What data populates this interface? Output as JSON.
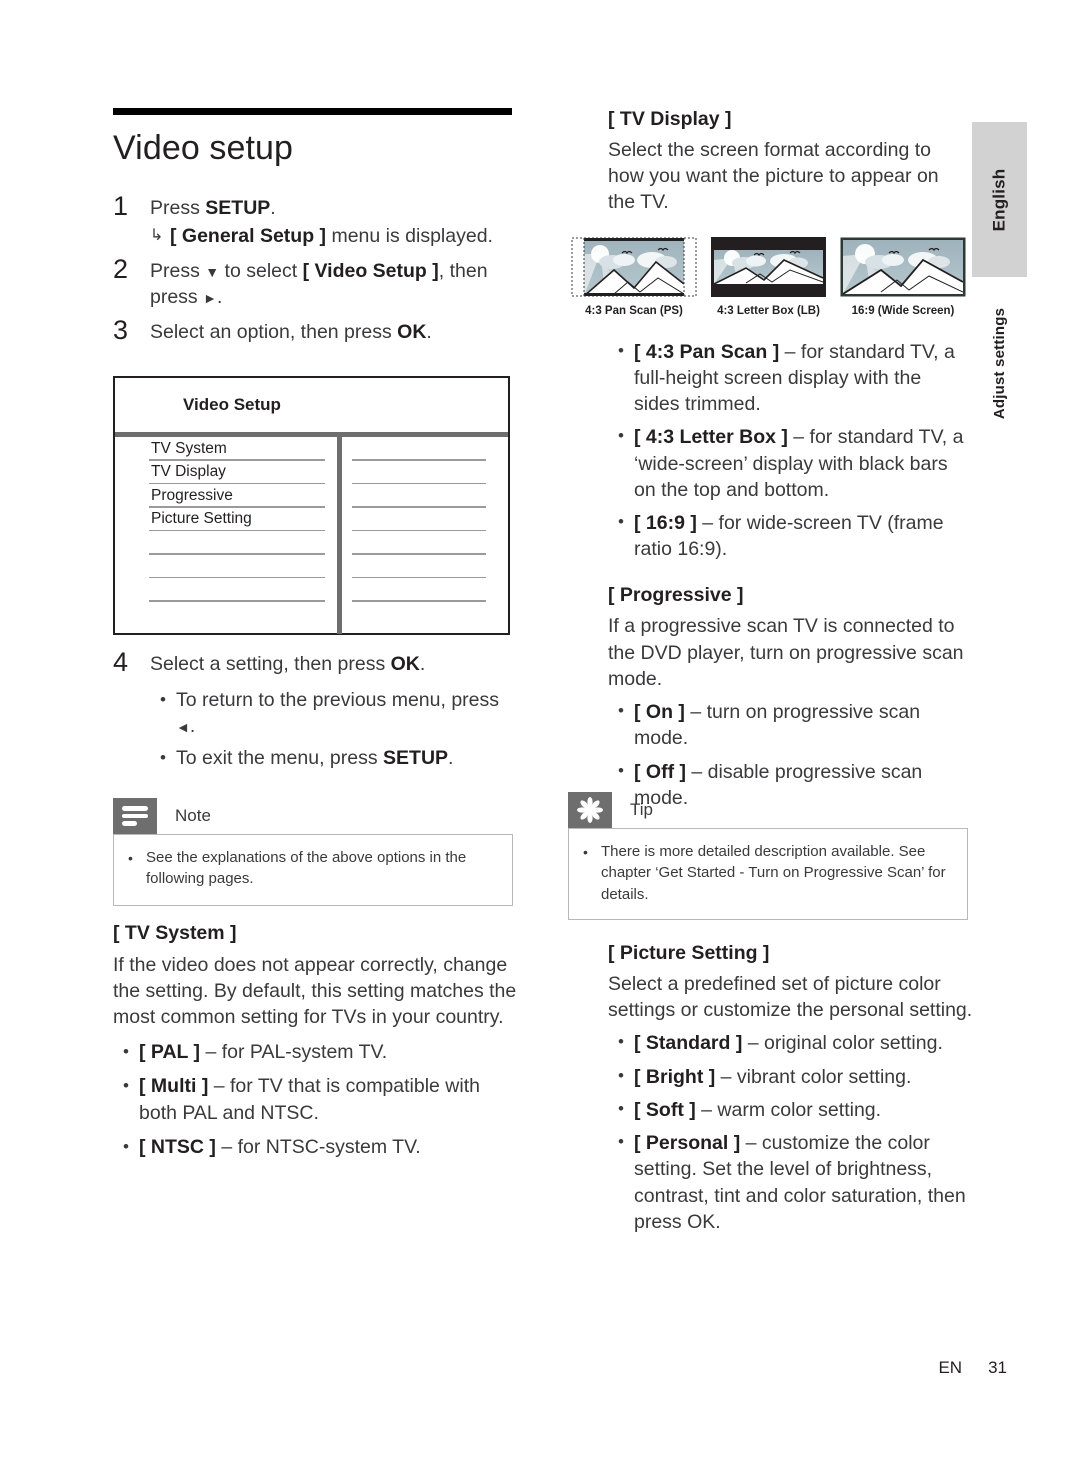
{
  "page": {
    "title": "Video setup",
    "footer_prefix": "EN",
    "footer_page": "31",
    "side_language": "English",
    "side_section": "Adjust settings"
  },
  "steps": [
    {
      "num": "1",
      "text_before": "Press ",
      "bold": "SETUP",
      "text_after": ".",
      "sub": {
        "arrow": "↳",
        "bold": "[ General Setup ]",
        "text_after": " menu is displayed."
      }
    },
    {
      "num": "2",
      "text_before": "Press ",
      "glyph1": "▼",
      "mid": " to select ",
      "bold": "[ Video Setup ]",
      "text_after": ", then press ",
      "glyph2": "►",
      "end": "."
    },
    {
      "num": "3",
      "text_before": "Select an option, then press ",
      "bold": "OK",
      "text_after": "."
    },
    {
      "num": "4",
      "text_before": "Select a setting, then press ",
      "bold": "OK",
      "text_after": ".",
      "bullets": [
        {
          "text_before": "To return to the previous menu, press ",
          "glyph": "◄",
          "text_after": "."
        },
        {
          "text_before": "To exit the menu, press ",
          "bold": "SETUP",
          "text_after": "."
        }
      ]
    }
  ],
  "video_setup_table": {
    "header": "Video Setup",
    "rows": [
      "TV System",
      "TV Display",
      "Progressive",
      "Picture Setting",
      "",
      "",
      "",
      ""
    ],
    "right_rows": [
      "",
      "",
      "",
      "",
      "",
      "",
      "",
      ""
    ]
  },
  "note": {
    "icon": "note-lines-icon",
    "label": "Note",
    "items": [
      "See the explanations of the above options in the following pages."
    ]
  },
  "tip": {
    "icon": "asterisk-icon",
    "label": "Tip",
    "items": [
      "There is more detailed description available. See chapter ‘Get Started - Turn on Progressive Scan’ for details."
    ]
  },
  "tv_system": {
    "heading": "[ TV System ]",
    "paragraph": "If the video does not appear correctly, change the setting. By default, this setting matches the most common setting for TVs in your country.",
    "bullets": [
      {
        "bold": "[ PAL ]",
        "rest": " – for PAL-system TV."
      },
      {
        "bold": "[ Multi ]",
        "rest": " – for TV that is compatible with both PAL and NTSC."
      },
      {
        "bold": "[ NTSC ]",
        "rest": " – for NTSC-system TV."
      }
    ]
  },
  "tv_display": {
    "heading": "[ TV Display ]",
    "paragraph": "Select the screen format according to how you want the picture to appear on the TV.",
    "figures": [
      {
        "name": "pan-scan-figure",
        "caption": "4:3 Pan Scan (PS)"
      },
      {
        "name": "letter-box-figure",
        "caption": "4:3 Letter Box (LB)"
      },
      {
        "name": "wide-screen-figure",
        "caption": "16:9 (Wide Screen)"
      }
    ],
    "bullets": [
      {
        "bold": "[ 4:3 Pan Scan ]",
        "rest": " – for standard TV, a full-height screen display with the sides trimmed."
      },
      {
        "bold": "[ 4:3 Letter Box ]",
        "rest": " – for standard TV,  a ‘wide-screen’ display with black bars on the top and bottom."
      },
      {
        "bold": "[ 16:9 ]",
        "rest": " – for wide-screen TV (frame ratio 16:9)."
      }
    ]
  },
  "progressive": {
    "heading": "[ Progressive ]",
    "paragraph": "If a progressive scan TV is connected to the DVD player, turn on progressive scan mode.",
    "bullets": [
      {
        "bold": "[ On ]",
        "rest": " – turn on progressive scan mode."
      },
      {
        "bold": "[ Off ]",
        "rest": " – disable progressive scan mode."
      }
    ]
  },
  "picture_setting": {
    "heading": "[ Picture Setting ]",
    "paragraph": "Select a predefined set of picture color settings or customize the personal setting.",
    "bullets": [
      {
        "bold": "[ Standard ]",
        "rest": " – original color setting."
      },
      {
        "bold": "[ Bright ]",
        "rest": " – vibrant color setting."
      },
      {
        "bold": "[ Soft ]",
        "rest": " – warm color setting."
      },
      {
        "bold": "[ Personal ]",
        "rest": " – customize the color setting. Set the level of brightness, contrast, tint and color saturation, then press OK."
      }
    ]
  },
  "colors": {
    "rule": "#000000",
    "callout_tab": "#6e6e6e",
    "table_divider": "#6e6e6e",
    "sky": "#9fb3bc",
    "side_tab": "#d2d2d2",
    "text": "#3a3a3c"
  }
}
